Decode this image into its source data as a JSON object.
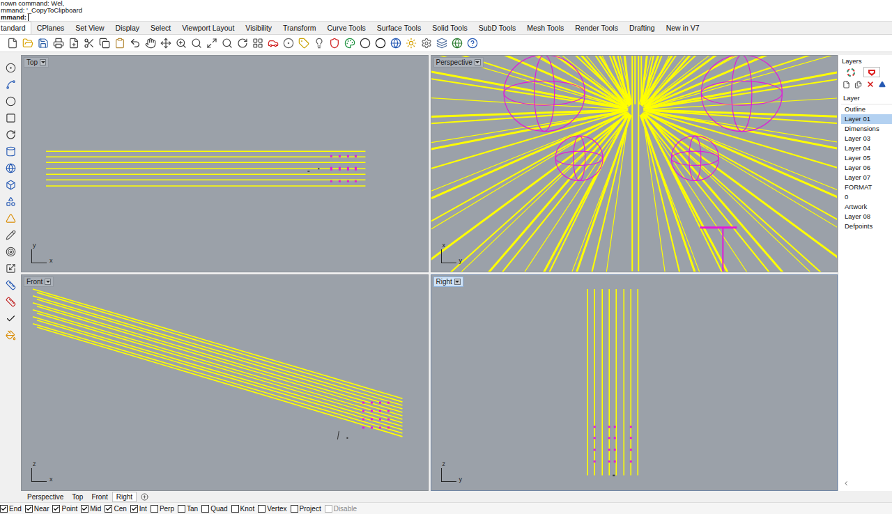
{
  "command_history": [
    "nown command: Wel,",
    "mmand: '_CopyToClipboard"
  ],
  "command_prompt": {
    "label": "mmand:",
    "value": ""
  },
  "tabs": [
    {
      "label": "tandard",
      "selected": true
    },
    {
      "label": "CPlanes",
      "selected": false
    },
    {
      "label": "Set View",
      "selected": false
    },
    {
      "label": "Display",
      "selected": false
    },
    {
      "label": "Select",
      "selected": false
    },
    {
      "label": "Viewport Layout",
      "selected": false
    },
    {
      "label": "Visibility",
      "selected": false
    },
    {
      "label": "Transform",
      "selected": false
    },
    {
      "label": "Curve Tools",
      "selected": false
    },
    {
      "label": "Surface Tools",
      "selected": false
    },
    {
      "label": "Solid Tools",
      "selected": false
    },
    {
      "label": "SubD Tools",
      "selected": false
    },
    {
      "label": "Mesh Tools",
      "selected": false
    },
    {
      "label": "Render Tools",
      "selected": false
    },
    {
      "label": "Drafting",
      "selected": false
    },
    {
      "label": "New in V7",
      "selected": false
    }
  ],
  "viewports": [
    {
      "title": "Top",
      "active": false,
      "axes": {
        "vertical": "y",
        "horizontal": "x"
      }
    },
    {
      "title": "Perspective",
      "active": false,
      "axes": {
        "vertical": "x",
        "horizontal": "y"
      }
    },
    {
      "title": "Front",
      "active": false,
      "axes": {
        "vertical": "z",
        "horizontal": "x"
      }
    },
    {
      "title": "Right",
      "active": true,
      "axes": {
        "vertical": "z",
        "horizontal": "y"
      }
    }
  ],
  "layers_panel": {
    "title": "Layers",
    "header": "Layer",
    "layers": [
      {
        "name": "Outline",
        "selected": false
      },
      {
        "name": "Layer 01",
        "selected": true
      },
      {
        "name": "Dimensions",
        "selected": false
      },
      {
        "name": "Layer 03",
        "selected": false
      },
      {
        "name": "Layer 04",
        "selected": false
      },
      {
        "name": "Layer 05",
        "selected": false
      },
      {
        "name": "Layer 06",
        "selected": false
      },
      {
        "name": "Layer 07",
        "selected": false
      },
      {
        "name": "FORMAT",
        "selected": false
      },
      {
        "name": "0",
        "selected": false
      },
      {
        "name": "Artwork",
        "selected": false
      },
      {
        "name": "Layer 08",
        "selected": false
      },
      {
        "name": "Defpoints",
        "selected": false
      }
    ]
  },
  "viewport_tabs": [
    {
      "label": "Perspective",
      "selected": false
    },
    {
      "label": "Top",
      "selected": false
    },
    {
      "label": "Front",
      "selected": false
    },
    {
      "label": "Right",
      "selected": true
    }
  ],
  "osnaps": [
    {
      "label": "End",
      "checked": true,
      "disabled": false
    },
    {
      "label": "Near",
      "checked": true,
      "disabled": false
    },
    {
      "label": "Point",
      "checked": true,
      "disabled": false
    },
    {
      "label": "Mid",
      "checked": true,
      "disabled": false
    },
    {
      "label": "Cen",
      "checked": true,
      "disabled": false
    },
    {
      "label": "Int",
      "checked": true,
      "disabled": false
    },
    {
      "label": "Perp",
      "checked": false,
      "disabled": false
    },
    {
      "label": "Tan",
      "checked": false,
      "disabled": false
    },
    {
      "label": "Quad",
      "checked": false,
      "disabled": false
    },
    {
      "label": "Knot",
      "checked": false,
      "disabled": false
    },
    {
      "label": "Vertex",
      "checked": false,
      "disabled": false
    },
    {
      "label": "Project",
      "checked": false,
      "disabled": false
    },
    {
      "label": "Disable",
      "checked": false,
      "disabled": true
    }
  ]
}
